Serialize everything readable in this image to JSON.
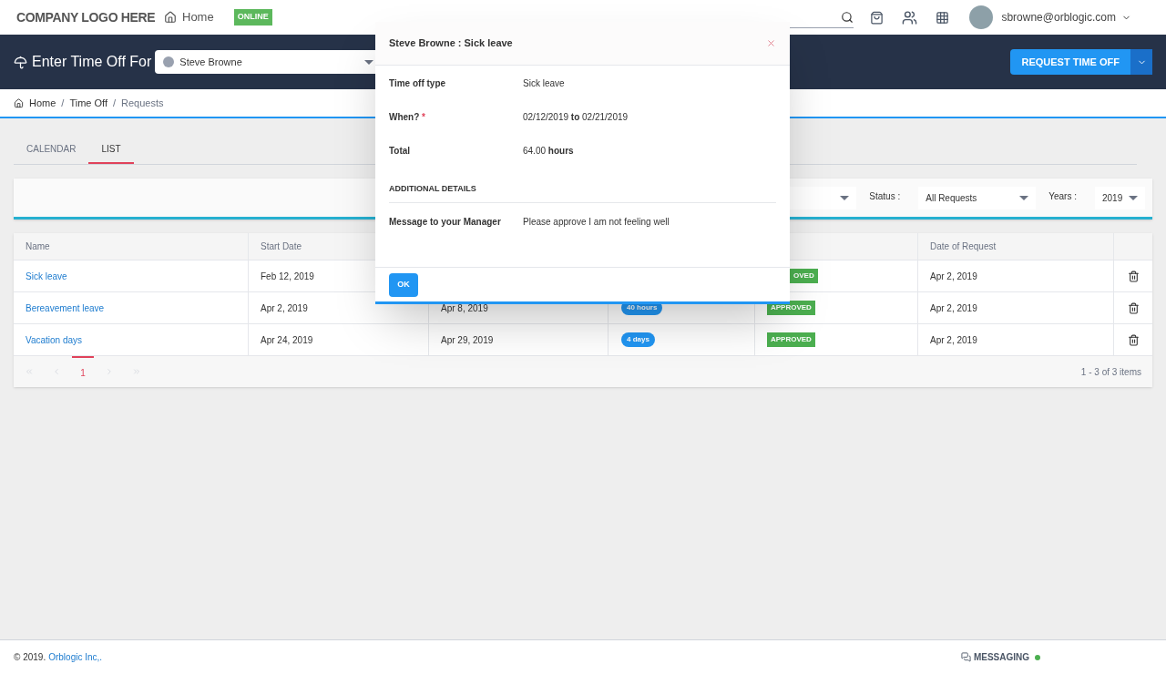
{
  "topbar": {
    "logo": "COMPANY LOGO HERE",
    "home": "Home",
    "status_badge": "ONLINE",
    "user_email": "sbrowne@orblogic.com"
  },
  "banner": {
    "title": "Enter Time Off For",
    "employee": "Steve Browne",
    "button": "REQUEST TIME OFF"
  },
  "breadcrumb": {
    "separator": "/",
    "items": [
      "Home",
      "Time Off",
      "Requests"
    ]
  },
  "tabs": [
    {
      "label": "CALENDAR",
      "selected": false
    },
    {
      "label": "LIST",
      "selected": true
    }
  ],
  "filters": {
    "status_label": "Status :",
    "status_value": "All Requests",
    "years_label": "Years :",
    "years_value": "2019"
  },
  "table": {
    "columns": [
      "Name",
      "Start Date",
      "",
      "",
      "",
      "Date of Request"
    ],
    "rows": [
      {
        "name": "Sick leave",
        "start": "Feb 12, 2019",
        "end": "",
        "duration": "",
        "status": "OVED",
        "requested": "Apr 2, 2019"
      },
      {
        "name": "Bereavement leave",
        "start": "Apr 2, 2019",
        "end": "Apr 8, 2019",
        "duration": "40 hours",
        "status": "APPROVED",
        "requested": "Apr 2, 2019"
      },
      {
        "name": "Vacation days",
        "start": "Apr 24, 2019",
        "end": "Apr 29, 2019",
        "duration": "4 days",
        "status": "APPROVED",
        "requested": "Apr 2, 2019"
      }
    ]
  },
  "pager": {
    "pages": [
      {
        "label": "1",
        "selected": true
      }
    ],
    "summary": "1 - 3 of 3 items"
  },
  "dialog": {
    "title": "Steve Browne : Sick leave",
    "required_mark": "*",
    "fields": [
      {
        "label": "Time off type",
        "value": "Sick leave",
        "required": false
      },
      {
        "label": "When?",
        "value": "02/12/2019 **to** 02/21/2019",
        "required": true
      },
      {
        "label": "Total",
        "value": "64.00 **hours**",
        "required": false
      }
    ],
    "section": "ADDITIONAL DETAILS",
    "message_label": "Message to your Manager",
    "message": "Please approve I am not feeling well",
    "ok": "OK"
  },
  "footer": {
    "copyright": "© 2019.",
    "company": "Orblogic Inc,.",
    "messaging": "MESSAGING",
    "messaging_online": true
  }
}
